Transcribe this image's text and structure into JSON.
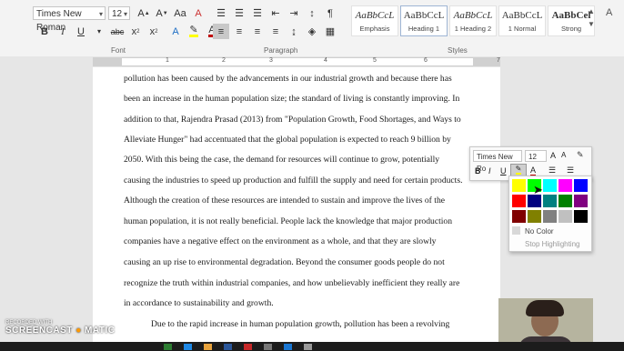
{
  "ribbon": {
    "font_name": "Times New Roman",
    "font_size": "12",
    "font_group_label": "Font",
    "paragraph_group_label": "Paragraph",
    "styles_group_label": "Styles",
    "styles": [
      {
        "preview": "AaBbCcL",
        "name": "Emphasis"
      },
      {
        "preview": "AaBbCcL",
        "name": "Heading 1"
      },
      {
        "preview": "AaBbCcL",
        "name": "1 Heading 2"
      },
      {
        "preview": "AaBbCcL",
        "name": "1 Normal"
      },
      {
        "preview": "AaBbCel",
        "name": "Strong"
      }
    ],
    "font_color": "#c00000",
    "highlight_color": "#ffff00"
  },
  "ruler": {
    "numbers": [
      "1",
      "2",
      "3",
      "4",
      "5",
      "6",
      "7"
    ]
  },
  "document": {
    "lines": [
      "pollution has been caused by the advancements in our industrial growth and because there has",
      "been an increase in the human population size; the standard of living is constantly improving. In",
      "addition to that, Rajendra Prasad (2013) from \"Population Growth, Food Shortages, and Ways to",
      "Alleviate Hunger\" had accentuated that the global population is expected to reach 9 billion by",
      "2050. With this being the case, the demand for resources will continue to grow, potentially",
      "causing the industries to speed up production and fulfill the supply and need for certain products.",
      "Although the creation of these resources are intended to sustain and improve the lives of the",
      "human population, it is not really beneficial. People lack the knowledge that major production",
      "companies have a negative effect on the environment as a whole, and that they are slowly",
      "causing an up rise to environmental degradation. Beyond the consumer goods people do not",
      "recognize the truth within industrial companies, and how unbelievably inefficient they really are",
      "in accordance to sustainability and growth.",
      "Due to the rapid increase in human population growth, pollution has been a revolving"
    ]
  },
  "minitoolbar": {
    "font_name": "Times New Ro",
    "font_size": "12"
  },
  "highlight_palette": {
    "colors": [
      "#ffff00",
      "#00ff00",
      "#00ffff",
      "#ff00ff",
      "#0000ff",
      "#ff0000",
      "#000080",
      "#008080",
      "#008000",
      "#800080",
      "#800000",
      "#808000",
      "#808080",
      "#c0c0c0",
      "#000000"
    ],
    "no_color_label": "No Color",
    "stop_label": "Stop Highlighting"
  },
  "watermark": {
    "line1": "RECORDED WITH",
    "line2": "SCREENCAST",
    "line3": "MATIC"
  }
}
